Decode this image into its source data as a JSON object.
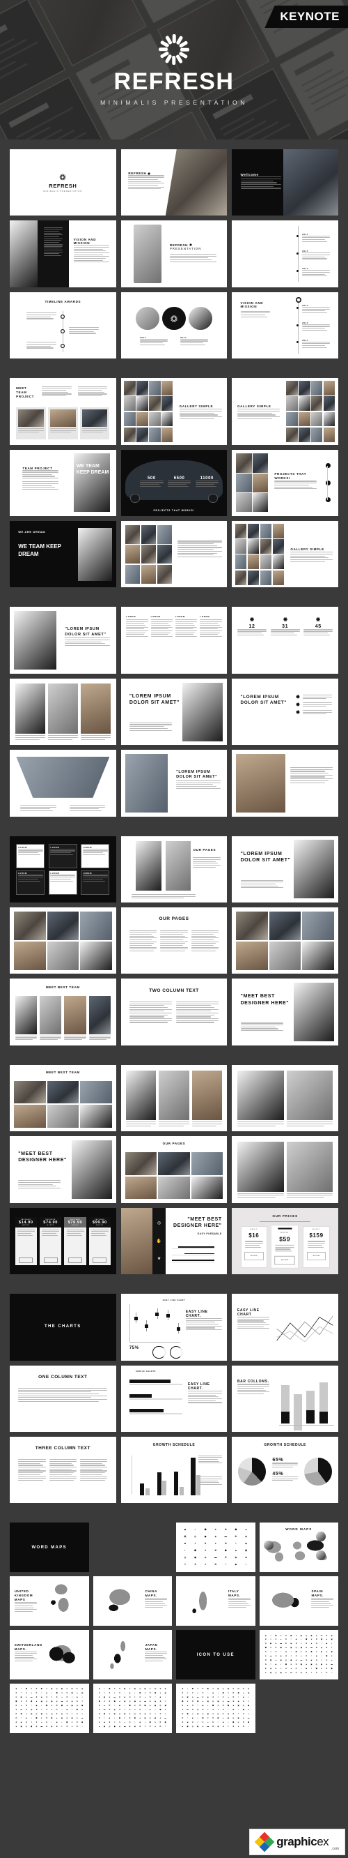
{
  "hero": {
    "badge": "KEYNOTE",
    "logo_icon": "sunburst-refresh-icon",
    "title": "REFRESH",
    "subtitle": "MINIMALIS PRESENTATION"
  },
  "sections": [
    {
      "id": "intro",
      "slides": [
        {
          "title": "REFRESH",
          "subtitle": "MINIMALIS PRESENTATION",
          "kind": "cover-logo"
        },
        {
          "title": "REFRESH",
          "kind": "cover-photo-diagonal"
        },
        {
          "title": "Wellcome",
          "kind": "dark-photo-text"
        },
        {
          "title": "VISION AND MISSION",
          "kind": "portrait-dark-text"
        },
        {
          "title": "REFRESH PRESENTATION",
          "kind": "cutout-person-text"
        },
        {
          "title": "",
          "kind": "timeline-right"
        },
        {
          "title": "TIMELINE AWARDS",
          "kind": "timeline-center"
        },
        {
          "title": "",
          "kind": "three-circles"
        },
        {
          "title": "VISION AND MISSION",
          "kind": "timeline-vertical"
        }
      ]
    },
    {
      "id": "team-gallery",
      "slides": [
        {
          "title": "MEET TEAM PROJECT",
          "kind": "team-three-cards"
        },
        {
          "title": "GALLERY SIMPLE",
          "kind": "gallery-left-mosaic"
        },
        {
          "title": "GALLERY SIMPLE",
          "kind": "gallery-right-mosaic"
        },
        {
          "title": "TEAM PROJECT",
          "quote": "WE TEAM KEEP DREAM",
          "kind": "text-quote-photo"
        },
        {
          "title": "PROJECTS THAT WORKS!",
          "kind": "car-stats",
          "stats": [
            "500",
            "6500",
            "11000"
          ]
        },
        {
          "title": "PROJECTS THAT WORKS!",
          "kind": "photo-strip-icons"
        },
        {
          "title": "WE ARE DREAM",
          "quote": "WE TEAM KEEP DREAM",
          "kind": "dark-quote"
        },
        {
          "title": "",
          "kind": "mosaic-text"
        },
        {
          "title": "GALLERY SIMPLE",
          "kind": "gallery-bottom"
        }
      ]
    },
    {
      "id": "quotes",
      "slides": [
        {
          "title": "\"LOREM IPSUM DOLOR SIT AMET\"",
          "kind": "quote-photo-left"
        },
        {
          "title": "",
          "kind": "four-column-text"
        },
        {
          "title": "",
          "kind": "stat-columns"
        },
        {
          "title": "",
          "kind": "photo-cards-row"
        },
        {
          "title": "\"LOREM IPSUM DOLOR SIT AMET\"",
          "kind": "quote-big"
        },
        {
          "title": "\"LOREM IPSUM DOLOR SIT AMET\"",
          "kind": "quote-icons"
        },
        {
          "title": "",
          "kind": "perspective-photo"
        },
        {
          "title": "\"LOREM IPSUM DOLOR SIT AMET\"",
          "kind": "quote-city"
        },
        {
          "title": "",
          "kind": "photo-text-right"
        }
      ]
    },
    {
      "id": "layouts",
      "slides": [
        {
          "title": "",
          "kind": "card-grid-dark"
        },
        {
          "title": "OUR PAGES",
          "kind": "cutouts-two"
        },
        {
          "title": "\"LOREM IPSUM DOLOR SIT AMET\"",
          "kind": "quote-window"
        },
        {
          "title": "",
          "kind": "photo-grid-6"
        },
        {
          "title": "OUR PAGES",
          "kind": "text-columns"
        },
        {
          "title": "",
          "kind": "windows-grid"
        },
        {
          "title": "MEET BEST TEAM",
          "kind": "team-row"
        },
        {
          "title": "TWO COLUMN TEXT",
          "kind": "two-column-text"
        },
        {
          "title": "\"MEET BEST DESIGNER HERE\"",
          "kind": "designer-quote"
        }
      ]
    },
    {
      "id": "team-prices",
      "slides": [
        {
          "title": "MEET BEST TEAM",
          "kind": "team-mosaic"
        },
        {
          "title": "",
          "kind": "people-row-light"
        },
        {
          "title": "",
          "kind": "people-pair"
        },
        {
          "title": "\"MEET BEST DESIGNER HERE\"",
          "kind": "designer-quote-2"
        },
        {
          "title": "OUR PAGES",
          "kind": "our-pages-cards"
        },
        {
          "title": "",
          "kind": "two-people"
        },
        {
          "title": "",
          "kind": "price-cards-dark",
          "prices": [
            "$14.90",
            "$74.90",
            "$76.90",
            "$99.90"
          ]
        },
        {
          "title": "\"MEET BEST DESIGNER HERE\"",
          "kind": "designer-skill",
          "skill_label": "EASY PURSABLE"
        },
        {
          "title": "OUR PRICES",
          "kind": "price-cards-light",
          "prices": [
            "$16",
            "$59",
            "$159"
          ]
        }
      ]
    },
    {
      "id": "charts",
      "slides": [
        {
          "title": "THE CHARTS",
          "kind": "section-title-dark"
        },
        {
          "title": "EASY LINE CHART.",
          "kind": "scatter-chart"
        },
        {
          "title": "EASY LINE CHART",
          "kind": "line-chart"
        },
        {
          "title": "ONE COLUMN TEXT",
          "kind": "one-column-text"
        },
        {
          "title": "EASY LINE CHART.",
          "kind": "h-bar-chart"
        },
        {
          "title": "BAR COLLOMS.",
          "kind": "stacked-bar-chart"
        },
        {
          "title": "THREE COLUMN TEXT",
          "kind": "three-column-text"
        },
        {
          "title": "GROWTH SCHEDULE",
          "kind": "grouped-bar-chart"
        },
        {
          "title": "GROWTH SCHEDULE",
          "kind": "pie-charts",
          "values": [
            "65%",
            "45%"
          ]
        }
      ]
    },
    {
      "id": "maps",
      "slides": [
        {
          "title": "WORD MAPS",
          "kind": "section-title-dark"
        },
        {
          "title": "",
          "kind": "empty"
        },
        {
          "title": "",
          "kind": "icon-grid-small"
        },
        {
          "title": "WORD MAPS",
          "kind": "world-map"
        },
        {
          "title": "UNITED KINGDOM MAPS",
          "kind": "uk-map"
        },
        {
          "title": "CHINA MAPS.",
          "kind": "china-map"
        },
        {
          "title": "ITALY MAPS.",
          "kind": "italy-map"
        },
        {
          "title": "SPAIN MAPS.",
          "kind": "spain-map"
        },
        {
          "title": "SWITZERLAND MAPS.",
          "kind": "swiss-map"
        },
        {
          "title": "JAPAN MAPS.",
          "kind": "japan-map"
        },
        {
          "title": "ICON TO USE",
          "kind": "section-title-dark"
        },
        {
          "title": "",
          "kind": "icon-grid-1"
        },
        {
          "title": "",
          "kind": "icon-grid-2"
        },
        {
          "title": "",
          "kind": "icon-grid-3"
        },
        {
          "title": "",
          "kind": "icon-grid-4"
        }
      ]
    }
  ],
  "percent_stats": {
    "donut": "75%",
    "pie_a": "65%",
    "pie_b": "45%"
  },
  "watermark": {
    "name": "graphic",
    "accent": "ex",
    "domain": ".com"
  },
  "colors": {
    "page_bg": "#3a3a3a",
    "slide_bg": "#ffffff",
    "dark": "#0c0c0c",
    "badge_bg": "#000000"
  }
}
